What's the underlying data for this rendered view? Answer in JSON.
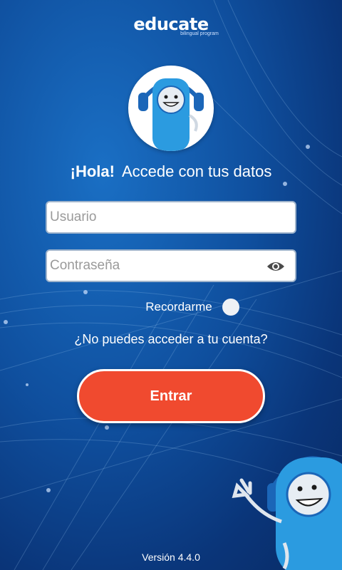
{
  "logo": {
    "word": "educate",
    "subtitle": "bilingual program"
  },
  "greeting": {
    "hola": "¡Hola!",
    "text": "Accede con tus datos"
  },
  "login": {
    "username_placeholder": "Usuario",
    "password_placeholder": "Contraseña",
    "remember_label": "Recordarme",
    "forgot_link": "¿No puedes acceder a tu cuenta?",
    "submit_label": "Entrar"
  },
  "version": "Versión 4.4.0",
  "colors": {
    "accent": "#f04a2f",
    "background": "#0f4f9e",
    "mascot": "#2b9be0"
  },
  "icons": {
    "password_toggle": "eye-icon"
  }
}
